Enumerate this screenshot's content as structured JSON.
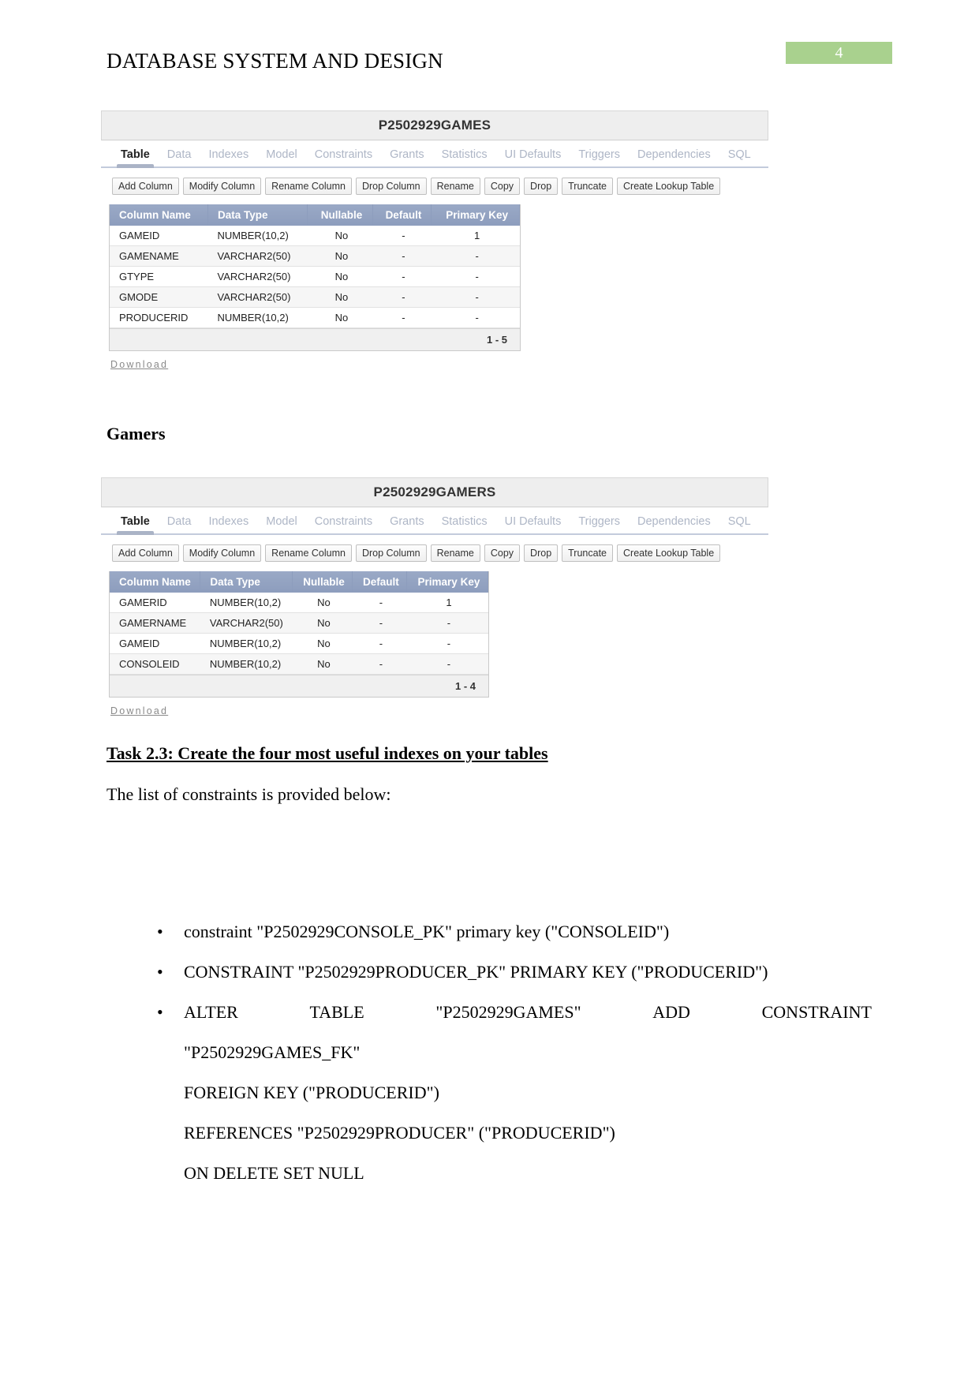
{
  "header": {
    "title": "DATABASE SYSTEM AND DESIGN",
    "page_number": "4",
    "badge_color": "#a9d18e"
  },
  "screenshots": [
    {
      "name": "games",
      "title": "P2502929GAMES",
      "tabs": [
        "Table",
        "Data",
        "Indexes",
        "Model",
        "Constraints",
        "Grants",
        "Statistics",
        "UI Defaults",
        "Triggers",
        "Dependencies",
        "SQL"
      ],
      "active_tab": "Table",
      "buttons": [
        "Add Column",
        "Modify Column",
        "Rename Column",
        "Drop Column",
        "Rename",
        "Copy",
        "Drop",
        "Truncate",
        "Create Lookup Table"
      ],
      "columns": [
        "Column Name",
        "Data Type",
        "Nullable",
        "Default",
        "Primary Key"
      ],
      "rows": [
        [
          "GAMEID",
          "NUMBER(10,2)",
          "No",
          "-",
          "1"
        ],
        [
          "GAMENAME",
          "VARCHAR2(50)",
          "No",
          "-",
          "-"
        ],
        [
          "GTYPE",
          "VARCHAR2(50)",
          "No",
          "-",
          "-"
        ],
        [
          "GMODE",
          "VARCHAR2(50)",
          "No",
          "-",
          "-"
        ],
        [
          "PRODUCERID",
          "NUMBER(10,2)",
          "No",
          "-",
          "-"
        ]
      ],
      "row_count_label": "1 - 5",
      "download_label": "Download"
    },
    {
      "name": "gamers",
      "title": "P2502929GAMERS",
      "tabs": [
        "Table",
        "Data",
        "Indexes",
        "Model",
        "Constraints",
        "Grants",
        "Statistics",
        "UI Defaults",
        "Triggers",
        "Dependencies",
        "SQL"
      ],
      "active_tab": "Table",
      "buttons": [
        "Add Column",
        "Modify Column",
        "Rename Column",
        "Drop Column",
        "Rename",
        "Copy",
        "Drop",
        "Truncate",
        "Create Lookup Table"
      ],
      "columns": [
        "Column Name",
        "Data Type",
        "Nullable",
        "Default",
        "Primary Key"
      ],
      "rows": [
        [
          "GAMERID",
          "NUMBER(10,2)",
          "No",
          "-",
          "1"
        ],
        [
          "GAMERNAME",
          "VARCHAR2(50)",
          "No",
          "-",
          "-"
        ],
        [
          "GAMEID",
          "NUMBER(10,2)",
          "No",
          "-",
          "-"
        ],
        [
          "CONSOLEID",
          "NUMBER(10,2)",
          "No",
          "-",
          "-"
        ]
      ],
      "row_count_label": "1 - 4",
      "download_label": "Download"
    }
  ],
  "body": {
    "gamers_heading": "Gamers",
    "task_heading": "Task 2.3: Create the four most useful indexes on your tables ",
    "intro_paragraph": "The list of constraints is provided below:",
    "bullets": [
      {
        "type": "simple",
        "text": "constraint  \"P2502929CONSOLE_PK\" primary key (\"CONSOLEID\")"
      },
      {
        "type": "simple",
        "text": "CONSTRAINT \"P2502929PRODUCER_PK\" PRIMARY KEY (\"PRODUCERID\")"
      },
      {
        "type": "multiline",
        "justified_words": [
          "ALTER",
          "TABLE",
          "\"P2502929GAMES\"",
          "ADD",
          "CONSTRAINT"
        ],
        "lines": [
          "\"P2502929GAMES_FK\"",
          "FOREIGN KEY (\"PRODUCERID\")",
          "REFERENCES \"P2502929PRODUCER\" (\"PRODUCERID\")",
          "ON DELETE SET NULL"
        ]
      }
    ]
  }
}
